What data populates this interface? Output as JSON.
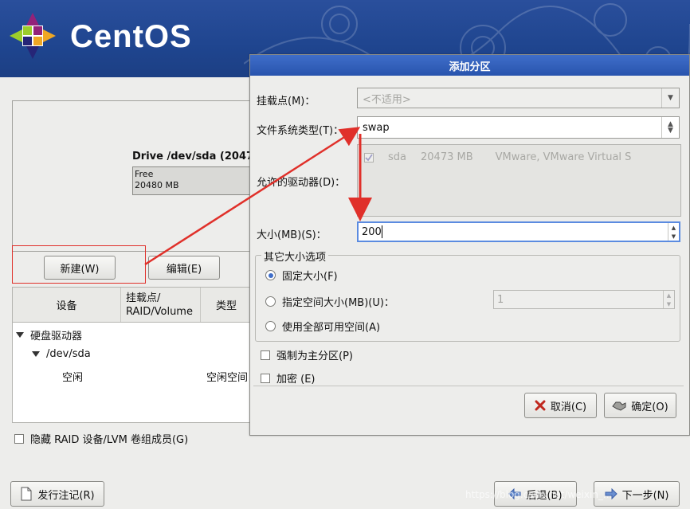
{
  "brand": {
    "name": "CentOS"
  },
  "main": {
    "drive_title": "Drive /dev/sda (2047",
    "drive_free_label": "Free",
    "drive_free_size": "20480 MB",
    "new_button": "新建(W)",
    "edit_button": "编辑(E)",
    "columns": [
      "设备",
      "挂载点/\nRAID/Volume",
      "类型"
    ],
    "tree": {
      "hard_drives": "硬盘驱动器",
      "device": "/dev/sda",
      "free_device": "空闲",
      "free_type": "空闲空间"
    },
    "hide_raid_label": "隐藏 RAID 设备/LVM 卷组成员(G)",
    "release_notes_button": "发行注记(R)",
    "back_button": "后退(B)",
    "next_button": "下一步(N)"
  },
  "dialog": {
    "title": "添加分区",
    "mount_label": "挂载点(M)：",
    "mount_value": "<不适用>",
    "fs_label": "文件系统类型(T)：",
    "fs_value": "swap",
    "drives_label": "允许的驱动器(D)：",
    "drive_row": {
      "name": "sda",
      "size": "20473 MB",
      "model": "VMware, VMware Virtual S"
    },
    "size_label": "大小(MB)(S)：",
    "size_value": "200",
    "other_size_title": "其它大小选项",
    "fixed_size_label": "固定大小(F)",
    "up_to_label": "指定空间大小(MB)(U)：",
    "up_to_value": "1",
    "fill_all_label": "使用全部可用空间(A)",
    "primary_label": "强制为主分区(P)",
    "encrypt_label": "加密 (E)",
    "cancel_button": "取消(C)",
    "ok_button": "确定(O)"
  },
  "watermark": "https://blog.csdn.net/weixin_...",
  "colors": {
    "title_bar": "#2854ad",
    "annotation": "#e0302a",
    "banner": "#1f458f"
  }
}
